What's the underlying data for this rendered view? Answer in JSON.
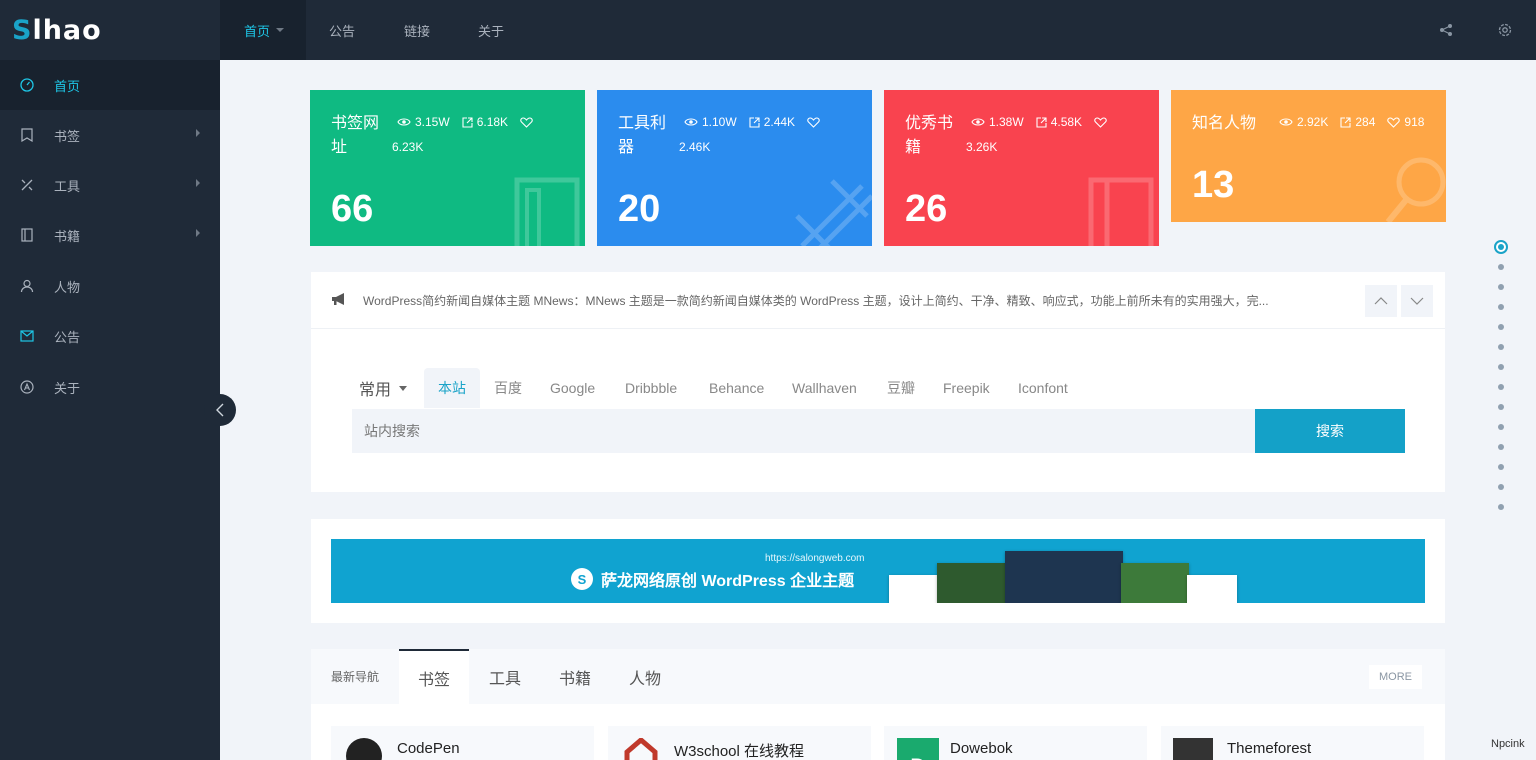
{
  "logo": {
    "text_s": "S",
    "text_rest": "lhao"
  },
  "sidebar": {
    "items": [
      {
        "label": "首页",
        "icon": "dashboard-icon",
        "active": true
      },
      {
        "label": "书签",
        "icon": "bookmark-icon",
        "submenu": true
      },
      {
        "label": "工具",
        "icon": "tools-icon",
        "submenu": true
      },
      {
        "label": "书籍",
        "icon": "book-icon",
        "submenu": true
      },
      {
        "label": "人物",
        "icon": "user-icon"
      },
      {
        "label": "公告",
        "icon": "mail-icon"
      },
      {
        "label": "关于",
        "icon": "about-icon"
      }
    ]
  },
  "topnav": {
    "items": [
      {
        "label": "首页",
        "active": true
      },
      {
        "label": "公告"
      },
      {
        "label": "链接"
      },
      {
        "label": "关于"
      }
    ],
    "icons": [
      "share-icon",
      "settings-icon"
    ]
  },
  "stat_cards": [
    {
      "name": "书签网址",
      "name_l1": "书签网",
      "name_l2": "址",
      "views": "3.15W",
      "links": "6.18K",
      "likes": "6.23K",
      "count": "66",
      "color": "#0fba82"
    },
    {
      "name": "工具利器",
      "name_l1": "工具利",
      "name_l2": "器",
      "views": "1.10W",
      "links": "2.44K",
      "likes": "2.46K",
      "count": "20",
      "color": "#2b8cee"
    },
    {
      "name": "优秀书籍",
      "name_l1": "优秀书",
      "name_l2": "籍",
      "views": "1.38W",
      "links": "4.58K",
      "likes": "3.26K",
      "count": "26",
      "color": "#f9434f"
    },
    {
      "name": "知名人物",
      "name_l1": "知名人物",
      "name_l2": "",
      "views": "2.92K",
      "links": "284",
      "likes": "918",
      "count": "13",
      "color": "#fea646"
    }
  ],
  "notice": {
    "text": "WordPress简约新闻自媒体主题 MNews：MNews 主题是一款简约新闻自媒体类的 WordPress 主题，设计上简约、干净、精致、响应式，功能上前所未有的实用强大，完..."
  },
  "search": {
    "group": "常用",
    "engines": [
      "本站",
      "百度",
      "Google",
      "Dribbble",
      "Behance",
      "Wallhaven",
      "豆瓣",
      "Freepik",
      "Iconfont"
    ],
    "placeholder": "站内搜索",
    "button": "搜索"
  },
  "banner": {
    "url": "https://salongweb.com",
    "logo": "S",
    "title": "萨龙网络原创  WordPress  企业主题"
  },
  "latest": {
    "label": "最新导航",
    "tabs": [
      "书签",
      "工具",
      "书籍",
      "人物"
    ],
    "more": "MORE",
    "sites": [
      {
        "name": "CodePen",
        "icon_color": "#222222"
      },
      {
        "name": "W3school 在线教程",
        "icon_color": "#c0392b"
      },
      {
        "name": "Dowebok",
        "icon_color": "#1aaa6e"
      },
      {
        "name": "Themeforest",
        "icon_color": "#333333"
      }
    ]
  },
  "scroll_dots": 14,
  "credit": "Npcink"
}
